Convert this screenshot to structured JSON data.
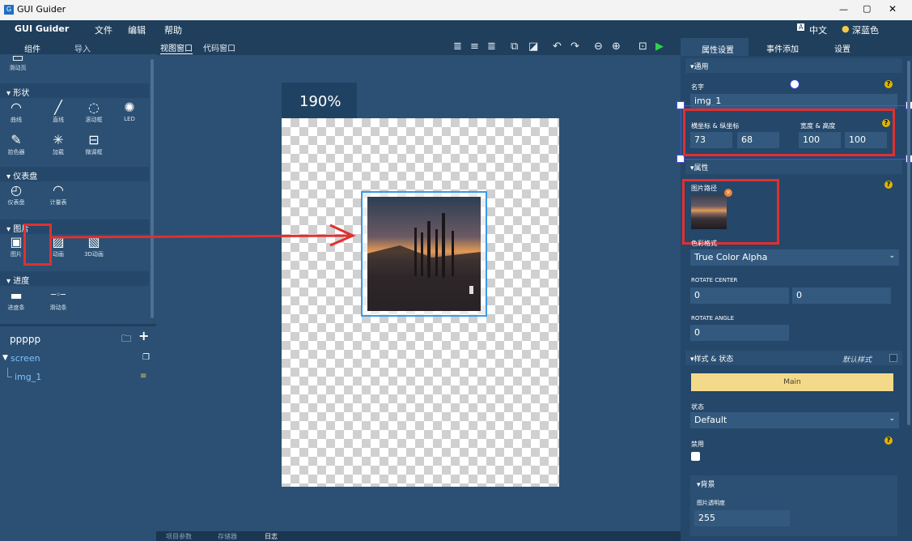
{
  "window": {
    "title": "GUI Guider",
    "controls": [
      "—",
      "▢",
      "✕"
    ]
  },
  "menubar": {
    "brand": "GUI Guider",
    "items": [
      "文件",
      "编辑",
      "帮助"
    ],
    "language": "中文",
    "theme": "深蓝色"
  },
  "left_tabs": [
    "组件",
    "导入"
  ],
  "widgets": {
    "top_item": "滑动页",
    "sections": [
      {
        "title": "▾ 形状",
        "items": [
          {
            "icon": "arc-icon",
            "glyph": "◠",
            "label": "曲线"
          },
          {
            "icon": "line-icon",
            "glyph": "╱",
            "label": "直线"
          },
          {
            "icon": "spinner-icon",
            "glyph": "◌",
            "label": "滚动框"
          },
          {
            "icon": "led-icon",
            "glyph": "✺",
            "label": "LED"
          },
          {
            "icon": "color-picker-icon",
            "glyph": "✎",
            "label": "拾色器"
          },
          {
            "icon": "loading-icon",
            "glyph": "✳",
            "label": "加载"
          },
          {
            "icon": "spinbox-icon",
            "glyph": "⊟",
            "label": "微调框"
          }
        ]
      },
      {
        "title": "▾ 仪表盘",
        "items": [
          {
            "icon": "gauge-icon",
            "glyph": "◴",
            "label": "仪表盘"
          },
          {
            "icon": "meter-icon",
            "glyph": "◠",
            "label": "计量表"
          }
        ]
      },
      {
        "title": "▾ 图片",
        "items": [
          {
            "icon": "image-icon",
            "glyph": "▣",
            "label": "图片"
          },
          {
            "icon": "animation-icon",
            "glyph": "▨",
            "label": "动画"
          },
          {
            "icon": "3d-animation-icon",
            "glyph": "▧",
            "label": "3D动画"
          }
        ]
      },
      {
        "title": "▾ 进度",
        "items": [
          {
            "icon": "progress-bar-icon",
            "glyph": "▬",
            "label": "进度条"
          },
          {
            "icon": "slider-icon",
            "glyph": "─◦─",
            "label": "滑动条"
          }
        ]
      }
    ]
  },
  "tree": {
    "project": "ppppp",
    "screen": "screen",
    "child": "img_1"
  },
  "canvas": {
    "tabs": [
      "视图窗口",
      "代码窗口"
    ],
    "zoom": "190%"
  },
  "status_tabs": [
    "项目参数",
    "存储器",
    "日志"
  ],
  "right": {
    "tabs": [
      "属性设置",
      "事件添加",
      "设置"
    ],
    "general_title": "▾通用",
    "name_label": "名字",
    "name_value": "img_1",
    "pos_label": "横坐标 & 纵坐标",
    "x": "73",
    "y": "68",
    "size_label": "宽度 & 高度",
    "w": "100",
    "h": "100",
    "attr_title": "▾属性",
    "path_label": "图片路径",
    "color_label": "色彩格式",
    "color_value": "True Color Alpha",
    "rotate_center_label": "ROTATE CENTER",
    "rc_x": "0",
    "rc_y": "0",
    "rotate_angle_label": "ROTATE ANGLE",
    "ra": "0",
    "style_title": "▾样式 & 状态",
    "default_style": "默认样式",
    "main_btn": "Main",
    "state_label": "状态",
    "state_value": "Default",
    "disable_label": "禁用",
    "bg_title": "▾背景",
    "opacity_label": "图片透明度",
    "opacity_value": "255"
  },
  "colors": {
    "accent_red": "#e03030",
    "main_button": "#f3d98a",
    "help": "#e0b400"
  }
}
